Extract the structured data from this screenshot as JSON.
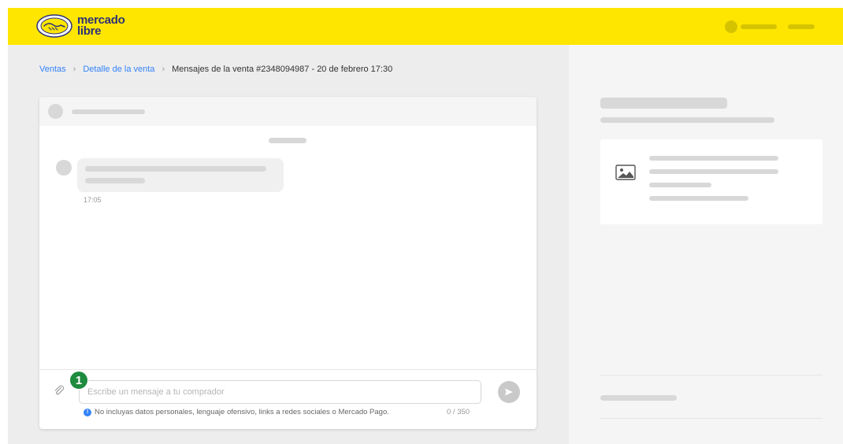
{
  "header": {
    "logo_text_line1": "mercado",
    "logo_text_line2": "libre",
    "brand_color": "#ffe600"
  },
  "breadcrumb": {
    "items": [
      "Ventas",
      "Detalle de la venta"
    ],
    "current": "Mensajes de la venta #2348094987 - 20 de febrero 17:30"
  },
  "chat": {
    "message_time": "17:05",
    "input_placeholder": "Escribe un mensaje a tu comprador",
    "info_text": "No incluyas datos personales, lenguaje ofensivo, links a redes sociales o Mercado Pago.",
    "char_counter": "0 / 350",
    "step_badge": "1",
    "badge_color": "#1e8b3f",
    "accent_color": "#3483fa"
  },
  "icons": {
    "attach": "paperclip-icon",
    "send": "send-icon",
    "product_image": "image-placeholder-icon",
    "info": "info-icon"
  }
}
